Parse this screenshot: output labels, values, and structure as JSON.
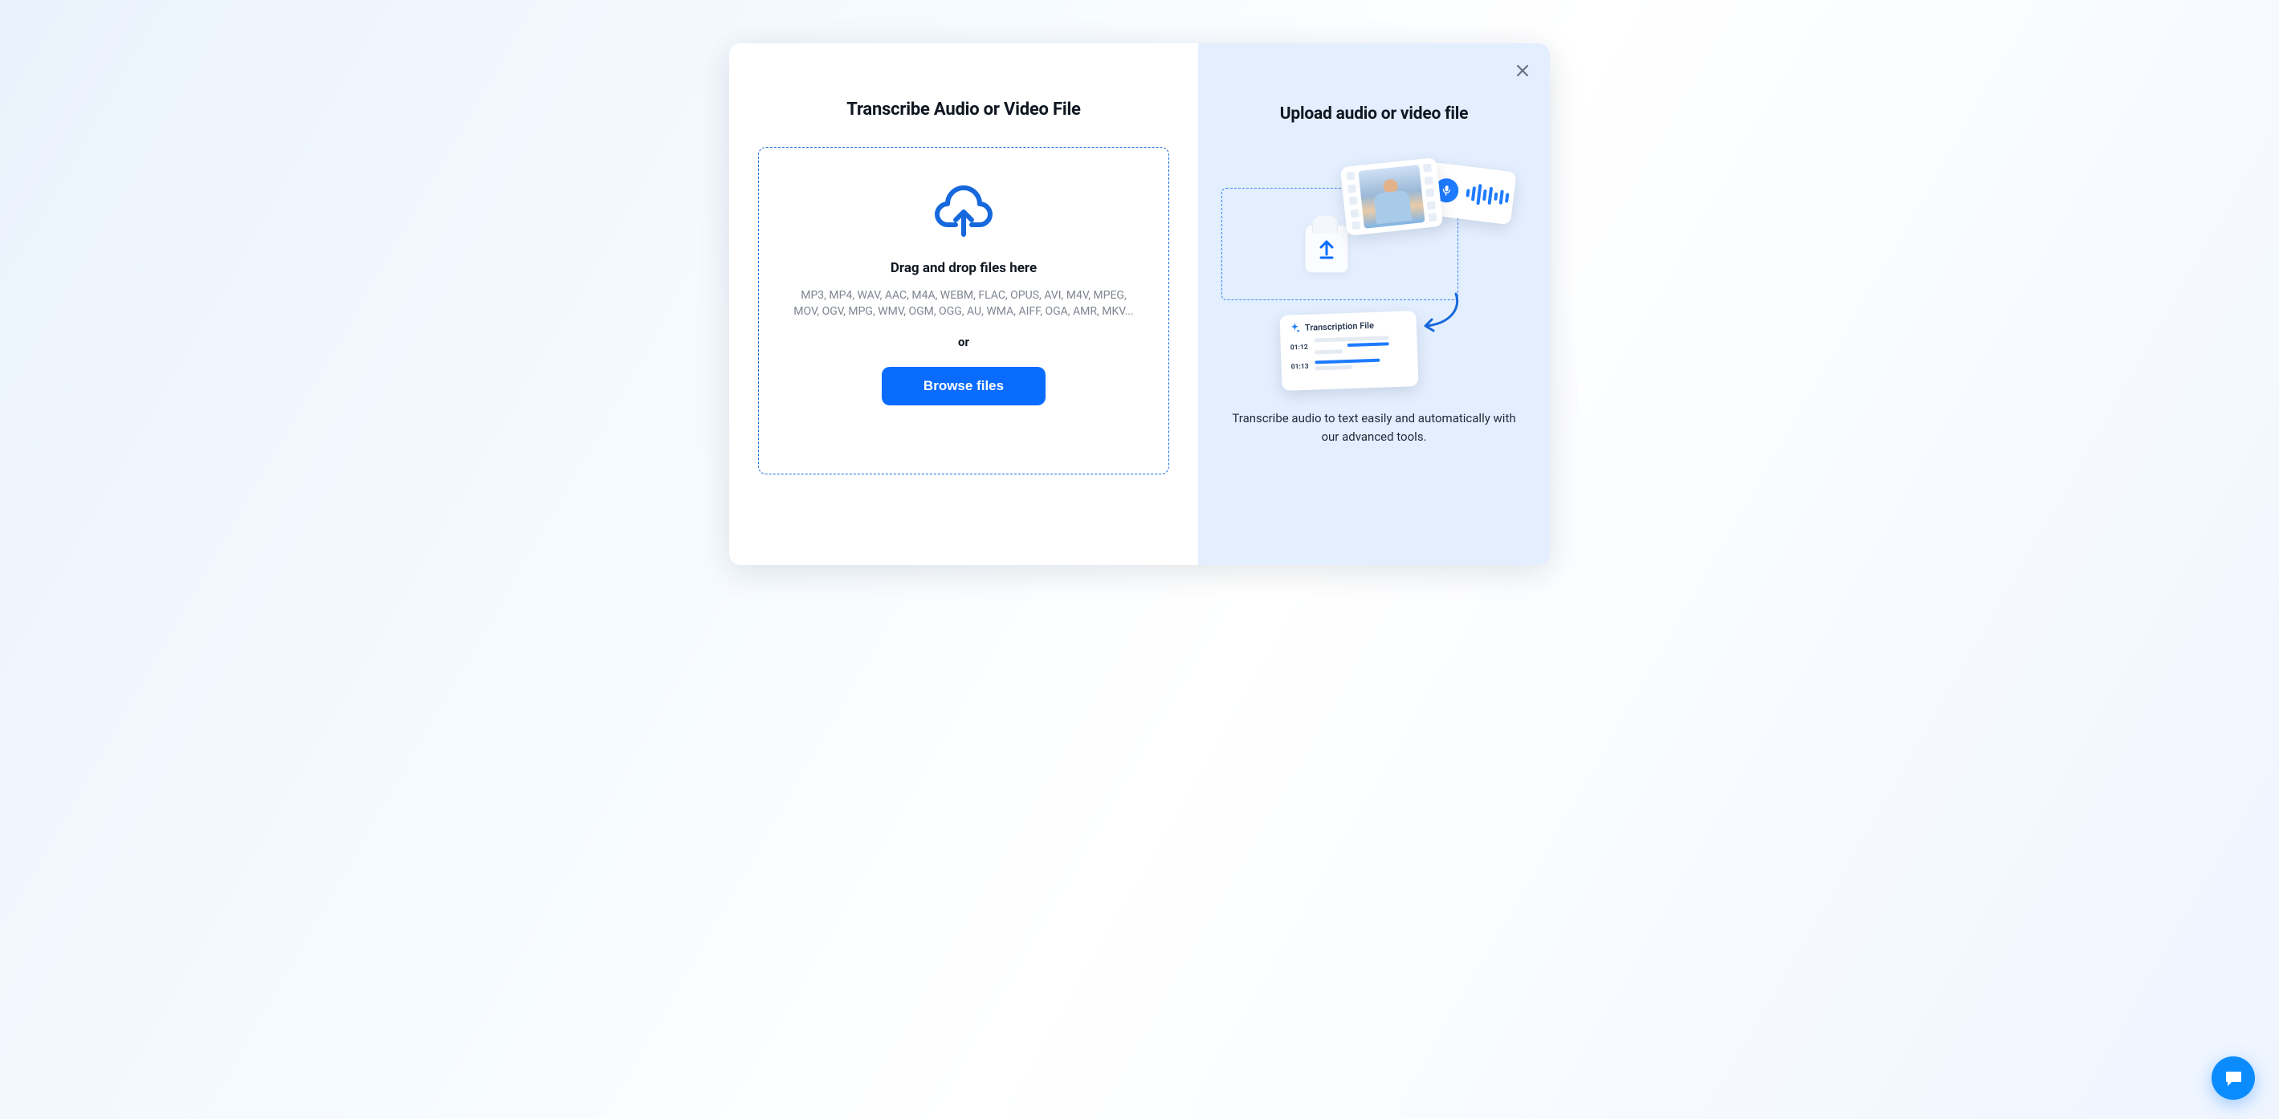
{
  "left": {
    "title": "Transcribe Audio or Video File",
    "dropzone": {
      "heading": "Drag and drop files here",
      "formats": "MP3, MP4, WAV, AAC, M4A, WEBM, FLAC, OPUS, AVI, M4V, MPEG, MOV, OGV, MPG, WMV, OGM, OGG, AU, WMA, AIFF, OGA, AMR, MKV...",
      "or": "or",
      "browse_label": "Browse files"
    }
  },
  "right": {
    "title": "Upload audio or video file",
    "caption": "Transcribe audio to text easily and automatically with our advanced tools.",
    "illustration": {
      "transcription_card": {
        "title": "Transcription File",
        "timestamps": [
          "01:12",
          "01:13"
        ]
      }
    }
  },
  "colors": {
    "accent": "#0a6cff",
    "panel_bg": "#e3eefe"
  }
}
